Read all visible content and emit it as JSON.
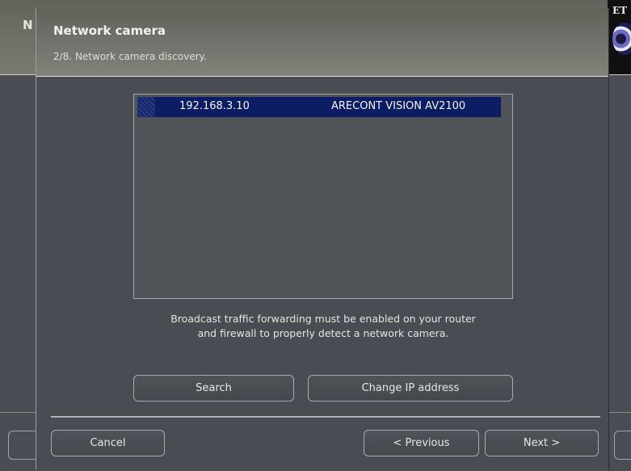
{
  "background_window": {
    "title_fragment": "N",
    "logo_text": "ET"
  },
  "dialog": {
    "title": "Network camera",
    "subtitle": "2/8. Network camera discovery."
  },
  "camera_list": {
    "rows": [
      {
        "ip": "192.168.3.10",
        "model": "ARECONT VISION AV2100",
        "selected": true
      }
    ]
  },
  "info_text": {
    "line1": "Broadcast traffic forwarding must be enabled on your router",
    "line2": "and firewall to properly detect a network camera."
  },
  "buttons": {
    "search": "Search",
    "change_ip": "Change IP address",
    "cancel": "Cancel",
    "previous": "< Previous",
    "next": "Next >"
  },
  "colors": {
    "selection": "#0c1d63",
    "dialog_bg": "#494d53",
    "header_bg": "#6f716a"
  }
}
